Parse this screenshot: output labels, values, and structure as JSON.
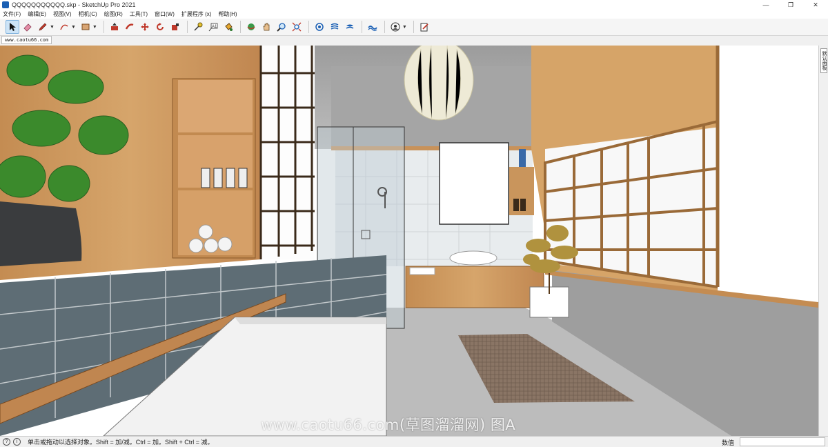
{
  "window": {
    "title": "QQQQQQQQQQQ.skp - SketchUp Pro 2021",
    "minimize_glyph": "—",
    "maximize_glyph": "❐",
    "close_glyph": "✕"
  },
  "menu": [
    "文件(F)",
    "编辑(E)",
    "视图(V)",
    "相机(C)",
    "绘图(R)",
    "工具(T)",
    "窗口(W)",
    "扩展程序 (x)",
    "帮助(H)"
  ],
  "toolbar": {
    "tools": [
      "select-icon",
      "eraser-icon",
      "pencil-icon",
      "arc-icon",
      "rectangle-icon",
      "push-pull-icon",
      "follow-me-icon",
      "move-icon",
      "rotate-icon",
      "scale-icon",
      "tape-measure-icon",
      "text-icon",
      "paint-bucket-icon",
      "orbit-icon",
      "pan-icon",
      "zoom-icon",
      "zoom-extents-icon",
      "warehouse-icon",
      "extension-warehouse-icon",
      "layout-icon",
      "sandbox-icon",
      "account-icon",
      "extension-manager-icon"
    ]
  },
  "scene": {
    "tab_label": "www.caotu66.com"
  },
  "tray": {
    "label": "默认面板"
  },
  "viewport": {
    "watermark": "www.caotu66.com(草图溜溜网) 图A"
  },
  "status": {
    "message": "单击或拖动以选择对象。Shift = 加/减。Ctrl = 加。Shift + Ctrl = 减。",
    "measure_label": "数值",
    "measure_value": ""
  },
  "colors": {
    "wood": "#c9955c",
    "concrete": "#a8a8a8",
    "tile": "#5c6b73",
    "accent": "#1a5fb4"
  }
}
